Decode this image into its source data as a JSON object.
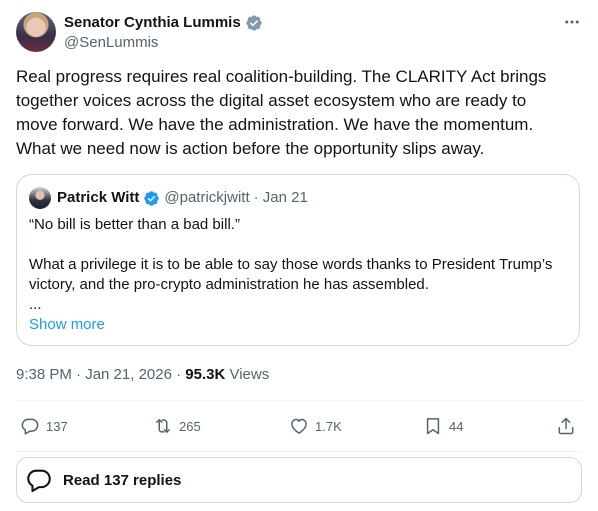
{
  "author": {
    "name": "Senator Cynthia Lummis",
    "handle": "@SenLummis"
  },
  "tweet": {
    "text": "Real progress requires real coalition-building. The CLARITY Act brings\ntogether voices across the digital asset ecosystem who are ready to\nmove forward. We have the administration. We have the momentum.\nWhat we need now is action before the opportunity slips away."
  },
  "quote": {
    "name": "Patrick Witt",
    "handle": "@patrickjwitt",
    "date": "· Jan 21",
    "text": "“No bill is better than a bad bill.”\n\nWhat a privilege it is to be able to say those words thanks to President Trump’s\nvictory, and the pro-crypto administration he has assembled.\n...",
    "show_more": "Show more"
  },
  "meta": {
    "time": "9:38 PM · Jan 21, 2026 · ",
    "views_count": "95.3K",
    "views_label": " Views"
  },
  "actions": {
    "replies": "137",
    "reposts": "265",
    "likes": "1.7K",
    "bookmarks": "44"
  },
  "read_replies": "Read 137 replies",
  "colors": {
    "text": "#0f1419",
    "secondary": "#536471",
    "link": "#1d9bf0",
    "verified_gray": "#829aab",
    "border": "#cfd9de"
  },
  "icons": [
    "verified-gray-icon",
    "verified-blue-icon",
    "more-icon",
    "reply-icon",
    "repost-icon",
    "like-icon",
    "bookmark-icon",
    "share-icon",
    "replies-icon"
  ]
}
